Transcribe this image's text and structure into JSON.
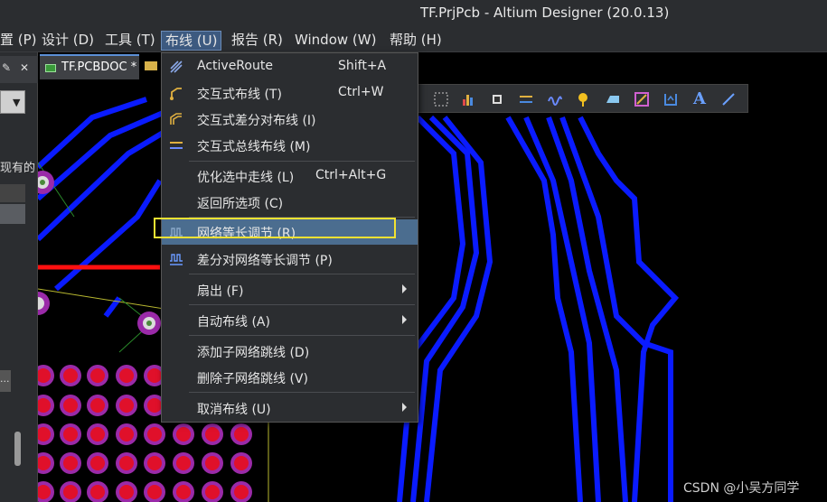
{
  "window": {
    "title": "TF.PrjPcb - Altium Designer (20.0.13)"
  },
  "menubar": [
    {
      "label": "置 (P)"
    },
    {
      "label": "设计 (D)"
    },
    {
      "label": "工具 (T)"
    },
    {
      "label": "布线 (U)"
    },
    {
      "label": "报告 (R)"
    },
    {
      "label": "Window (W)"
    },
    {
      "label": "帮助 (H)"
    }
  ],
  "left_panel": {
    "partial_text": "现有的",
    "more_button": "..."
  },
  "tab": {
    "label": "TF.PCBDOC *"
  },
  "dropdown": {
    "items": [
      {
        "label": "ActiveRoute",
        "shortcut": "Shift+A",
        "icon": "active-route-icon"
      },
      {
        "label": "交互式布线 (T)",
        "shortcut": "Ctrl+W",
        "icon": "interactive-route-icon"
      },
      {
        "label": "交互式差分对布线 (I)",
        "shortcut": "",
        "icon": "diff-pair-route-icon"
      },
      {
        "label": "交互式总线布线 (M)",
        "shortcut": "",
        "icon": "bus-route-icon"
      },
      {
        "label": "优化选中走线 (L)",
        "shortcut": "Ctrl+Alt+G",
        "icon": ""
      },
      {
        "label": "返回所选项 (C)",
        "shortcut": "",
        "icon": ""
      },
      {
        "label": "网络等长调节 (R)",
        "shortcut": "",
        "icon": "length-tune-icon"
      },
      {
        "label": "差分对网络等长调节 (P)",
        "shortcut": "",
        "icon": "diff-length-tune-icon"
      },
      {
        "label": "扇出 (F)",
        "shortcut": "",
        "icon": ""
      },
      {
        "label": "自动布线 (A)",
        "shortcut": "",
        "icon": ""
      },
      {
        "label": "添加子网络跳线 (D)",
        "shortcut": "",
        "icon": ""
      },
      {
        "label": "删除子网络跳线 (V)",
        "shortcut": "",
        "icon": ""
      },
      {
        "label": "取消布线 (U)",
        "shortcut": "",
        "icon": ""
      }
    ]
  },
  "toolbar": {
    "text_tool_glyph": "A"
  },
  "watermark": "CSDN @小吴方同学",
  "colors": {
    "track_blue": "#0a1bff",
    "highlight": "#f2e232",
    "menu_bg": "#2b2d30",
    "hover_row": "#4b6d8f",
    "pad_red": "#e0102a",
    "pad_ring": "#9a2aa8"
  }
}
